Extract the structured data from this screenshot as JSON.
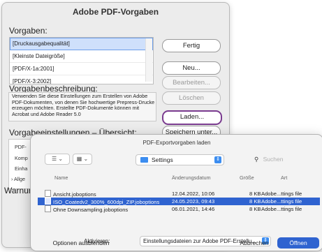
{
  "window": {
    "title": "Adobe PDF-Vorgaben",
    "vorgaben_label": "Vorgaben:",
    "presets": [
      {
        "label": "[Druckausgabequalität]",
        "selected": true
      },
      {
        "label": "[Kleinste Dateigröße]",
        "selected": false
      },
      {
        "label": "[PDF/X-1a:2001]",
        "selected": false
      },
      {
        "label": "[PDF/X-3:2002]",
        "selected": false
      }
    ],
    "desc_label": "Vorgabenbeschreibung:",
    "desc_text": "Verwenden Sie diese Einstellungen zum Erstellen von Adobe PDF-Dokumenten, von denen Sie hochwertige Prepress-Drucke erzeugen möchten. Erstellte PDF-Dokumente können mit Acrobat und Adobe Reader 5.0",
    "overview_label": "Vorgabeeinstellungen – Übersicht:",
    "overview_items": [
      "PDF-",
      "Komp",
      "Einha",
      "Allge"
    ],
    "warn_label": "Warnun",
    "buttons": {
      "fertig": "Fertig",
      "neu": "Neu...",
      "bearbeiten": "Bearbeiten...",
      "loeschen": "Löschen",
      "laden": "Laden...",
      "speichern": "Speichern unter..."
    }
  },
  "dialog": {
    "title": "PDF-Exportvorgaben laden",
    "folder": "Settings",
    "search_placeholder": "Suchen",
    "columns": {
      "name": "Name",
      "date": "Änderungsdatum",
      "size": "Größe",
      "kind": "Art"
    },
    "files": [
      {
        "name": "Ansicht.joboptions",
        "date": "12.04.2022, 10:06",
        "size": "8 KB",
        "kind": "Adobe...ttings file",
        "selected": false
      },
      {
        "name": "ISO_Coatedv2_300%_600dpi_ZIP.joboptions",
        "date": "24.05.2023, 09:43",
        "size": "8 KB",
        "kind": "Adobe...ttings file",
        "selected": true
      },
      {
        "name": "Ohne Downsampling.joboptions",
        "date": "06.01.2021, 14:46",
        "size": "8 KB",
        "kind": "Adobe...ttings file",
        "selected": false
      }
    ],
    "aktivieren_label": "Aktivieren:",
    "aktivieren_value": "Einstellungsdateien zur Adobe PDF-Erstellu...",
    "hide_options": "Optionen ausblenden",
    "cancel": "Abbrechen",
    "open": "Öffnen",
    "accent": "#2f63d0"
  }
}
